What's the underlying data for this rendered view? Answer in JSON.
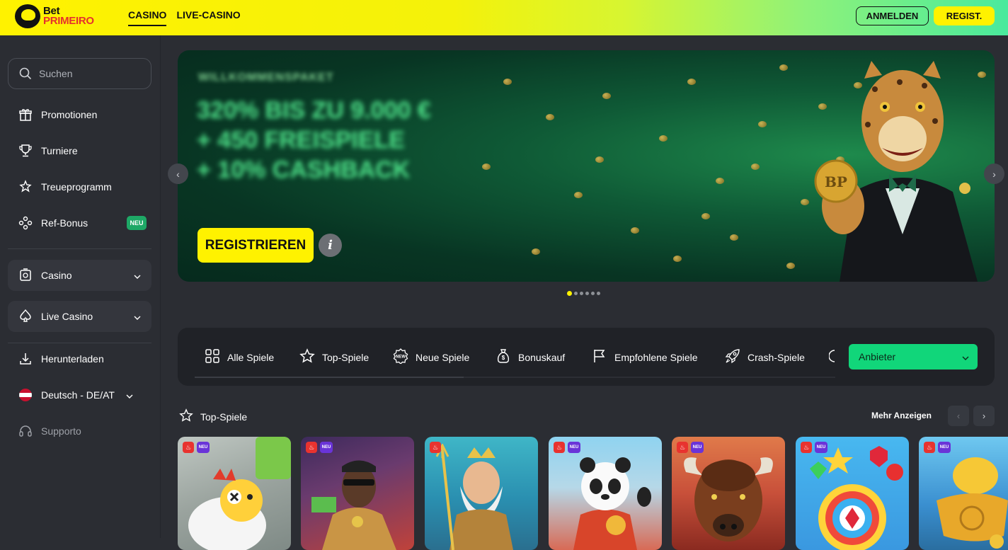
{
  "header": {
    "logo_top": "Bet",
    "logo_bottom": "PRIMEIRO",
    "nav": [
      "CASINO",
      "LIVE-CASINO"
    ],
    "login_label": "ANMELDEN",
    "register_label": "REGIST."
  },
  "sidebar": {
    "search_placeholder": "Suchen",
    "items": [
      {
        "label": "Promotionen",
        "icon": "gift-icon"
      },
      {
        "label": "Turniere",
        "icon": "trophy-icon"
      },
      {
        "label": "Treueprogramm",
        "icon": "loyalty-icon"
      },
      {
        "label": "Ref-Bonus",
        "icon": "referral-icon",
        "badge": "NEU"
      }
    ],
    "blocks": [
      {
        "label": "Casino",
        "icon": "casino-chip-icon"
      },
      {
        "label": "Live Casino",
        "icon": "spade-icon"
      }
    ],
    "download_label": "Herunterladen",
    "language_label": "Deutsch - DE/AT",
    "support_label": "Supporto"
  },
  "banner": {
    "subtitle": "WILLKOMMENSPAKET",
    "title_lines": [
      "320% BIS ZU 9.000 €",
      "+ 450 FREISPIELE",
      "+ 10% CASHBACK"
    ],
    "cta_label": "REGISTRIEREN",
    "info_label": "i",
    "coin_text": "BP",
    "slides": 6,
    "active_slide": 1
  },
  "categories": {
    "items": [
      {
        "label": "Alle Spiele",
        "icon": "grid-icon"
      },
      {
        "label": "Top-Spiele",
        "icon": "star-icon"
      },
      {
        "label": "Neue Spiele",
        "icon": "new-badge-icon"
      },
      {
        "label": "Bonuskauf",
        "icon": "money-bag-icon"
      },
      {
        "label": "Empfohlene Spiele",
        "icon": "flag-icon"
      },
      {
        "label": "Crash-Spiele",
        "icon": "rocket-icon"
      }
    ],
    "provider_label": "Anbieter"
  },
  "top_games": {
    "title": "Top-Spiele",
    "more_label": "Mehr Anzeigen",
    "new_tag": "NEU",
    "games": [
      {
        "theme": "chicken",
        "new": true
      },
      {
        "theme": "snoop",
        "new": true
      },
      {
        "theme": "zeus",
        "new": false
      },
      {
        "theme": "panda",
        "new": true
      },
      {
        "theme": "buffalo",
        "new": true
      },
      {
        "theme": "gems",
        "new": true
      },
      {
        "theme": "gold",
        "new": true
      }
    ]
  },
  "colors": {
    "accent_yellow": "#fff200",
    "accent_green": "#11d67a",
    "sidebar_bg": "#2b2d33"
  }
}
